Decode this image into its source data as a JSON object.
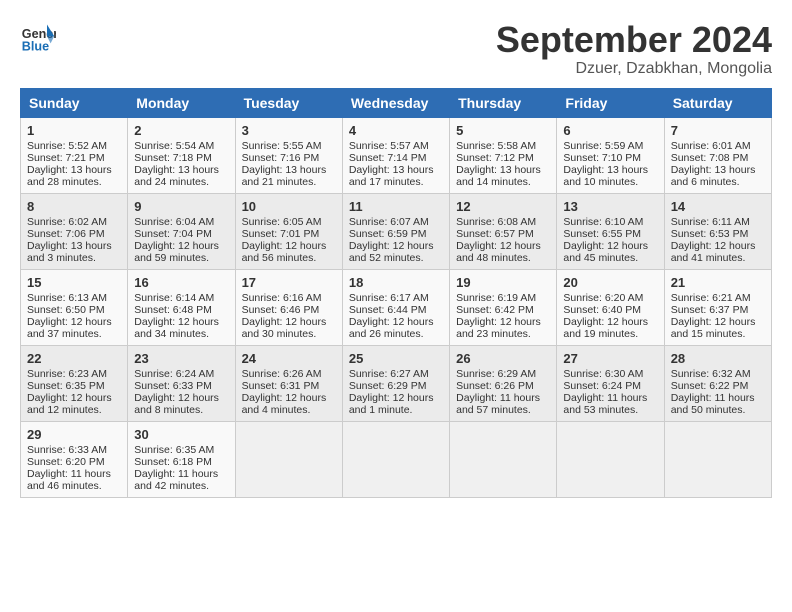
{
  "header": {
    "logo_line1": "General",
    "logo_line2": "Blue",
    "month_title": "September 2024",
    "subtitle": "Dzuer, Dzabkhan, Mongolia"
  },
  "weekdays": [
    "Sunday",
    "Monday",
    "Tuesday",
    "Wednesday",
    "Thursday",
    "Friday",
    "Saturday"
  ],
  "weeks": [
    [
      {
        "day": "1",
        "lines": [
          "Sunrise: 5:52 AM",
          "Sunset: 7:21 PM",
          "Daylight: 13 hours",
          "and 28 minutes."
        ]
      },
      {
        "day": "2",
        "lines": [
          "Sunrise: 5:54 AM",
          "Sunset: 7:18 PM",
          "Daylight: 13 hours",
          "and 24 minutes."
        ]
      },
      {
        "day": "3",
        "lines": [
          "Sunrise: 5:55 AM",
          "Sunset: 7:16 PM",
          "Daylight: 13 hours",
          "and 21 minutes."
        ]
      },
      {
        "day": "4",
        "lines": [
          "Sunrise: 5:57 AM",
          "Sunset: 7:14 PM",
          "Daylight: 13 hours",
          "and 17 minutes."
        ]
      },
      {
        "day": "5",
        "lines": [
          "Sunrise: 5:58 AM",
          "Sunset: 7:12 PM",
          "Daylight: 13 hours",
          "and 14 minutes."
        ]
      },
      {
        "day": "6",
        "lines": [
          "Sunrise: 5:59 AM",
          "Sunset: 7:10 PM",
          "Daylight: 13 hours",
          "and 10 minutes."
        ]
      },
      {
        "day": "7",
        "lines": [
          "Sunrise: 6:01 AM",
          "Sunset: 7:08 PM",
          "Daylight: 13 hours",
          "and 6 minutes."
        ]
      }
    ],
    [
      {
        "day": "8",
        "lines": [
          "Sunrise: 6:02 AM",
          "Sunset: 7:06 PM",
          "Daylight: 13 hours",
          "and 3 minutes."
        ]
      },
      {
        "day": "9",
        "lines": [
          "Sunrise: 6:04 AM",
          "Sunset: 7:04 PM",
          "Daylight: 12 hours",
          "and 59 minutes."
        ]
      },
      {
        "day": "10",
        "lines": [
          "Sunrise: 6:05 AM",
          "Sunset: 7:01 PM",
          "Daylight: 12 hours",
          "and 56 minutes."
        ]
      },
      {
        "day": "11",
        "lines": [
          "Sunrise: 6:07 AM",
          "Sunset: 6:59 PM",
          "Daylight: 12 hours",
          "and 52 minutes."
        ]
      },
      {
        "day": "12",
        "lines": [
          "Sunrise: 6:08 AM",
          "Sunset: 6:57 PM",
          "Daylight: 12 hours",
          "and 48 minutes."
        ]
      },
      {
        "day": "13",
        "lines": [
          "Sunrise: 6:10 AM",
          "Sunset: 6:55 PM",
          "Daylight: 12 hours",
          "and 45 minutes."
        ]
      },
      {
        "day": "14",
        "lines": [
          "Sunrise: 6:11 AM",
          "Sunset: 6:53 PM",
          "Daylight: 12 hours",
          "and 41 minutes."
        ]
      }
    ],
    [
      {
        "day": "15",
        "lines": [
          "Sunrise: 6:13 AM",
          "Sunset: 6:50 PM",
          "Daylight: 12 hours",
          "and 37 minutes."
        ]
      },
      {
        "day": "16",
        "lines": [
          "Sunrise: 6:14 AM",
          "Sunset: 6:48 PM",
          "Daylight: 12 hours",
          "and 34 minutes."
        ]
      },
      {
        "day": "17",
        "lines": [
          "Sunrise: 6:16 AM",
          "Sunset: 6:46 PM",
          "Daylight: 12 hours",
          "and 30 minutes."
        ]
      },
      {
        "day": "18",
        "lines": [
          "Sunrise: 6:17 AM",
          "Sunset: 6:44 PM",
          "Daylight: 12 hours",
          "and 26 minutes."
        ]
      },
      {
        "day": "19",
        "lines": [
          "Sunrise: 6:19 AM",
          "Sunset: 6:42 PM",
          "Daylight: 12 hours",
          "and 23 minutes."
        ]
      },
      {
        "day": "20",
        "lines": [
          "Sunrise: 6:20 AM",
          "Sunset: 6:40 PM",
          "Daylight: 12 hours",
          "and 19 minutes."
        ]
      },
      {
        "day": "21",
        "lines": [
          "Sunrise: 6:21 AM",
          "Sunset: 6:37 PM",
          "Daylight: 12 hours",
          "and 15 minutes."
        ]
      }
    ],
    [
      {
        "day": "22",
        "lines": [
          "Sunrise: 6:23 AM",
          "Sunset: 6:35 PM",
          "Daylight: 12 hours",
          "and 12 minutes."
        ]
      },
      {
        "day": "23",
        "lines": [
          "Sunrise: 6:24 AM",
          "Sunset: 6:33 PM",
          "Daylight: 12 hours",
          "and 8 minutes."
        ]
      },
      {
        "day": "24",
        "lines": [
          "Sunrise: 6:26 AM",
          "Sunset: 6:31 PM",
          "Daylight: 12 hours",
          "and 4 minutes."
        ]
      },
      {
        "day": "25",
        "lines": [
          "Sunrise: 6:27 AM",
          "Sunset: 6:29 PM",
          "Daylight: 12 hours",
          "and 1 minute."
        ]
      },
      {
        "day": "26",
        "lines": [
          "Sunrise: 6:29 AM",
          "Sunset: 6:26 PM",
          "Daylight: 11 hours",
          "and 57 minutes."
        ]
      },
      {
        "day": "27",
        "lines": [
          "Sunrise: 6:30 AM",
          "Sunset: 6:24 PM",
          "Daylight: 11 hours",
          "and 53 minutes."
        ]
      },
      {
        "day": "28",
        "lines": [
          "Sunrise: 6:32 AM",
          "Sunset: 6:22 PM",
          "Daylight: 11 hours",
          "and 50 minutes."
        ]
      }
    ],
    [
      {
        "day": "29",
        "lines": [
          "Sunrise: 6:33 AM",
          "Sunset: 6:20 PM",
          "Daylight: 11 hours",
          "and 46 minutes."
        ]
      },
      {
        "day": "30",
        "lines": [
          "Sunrise: 6:35 AM",
          "Sunset: 6:18 PM",
          "Daylight: 11 hours",
          "and 42 minutes."
        ]
      },
      {
        "day": "",
        "lines": []
      },
      {
        "day": "",
        "lines": []
      },
      {
        "day": "",
        "lines": []
      },
      {
        "day": "",
        "lines": []
      },
      {
        "day": "",
        "lines": []
      }
    ]
  ]
}
